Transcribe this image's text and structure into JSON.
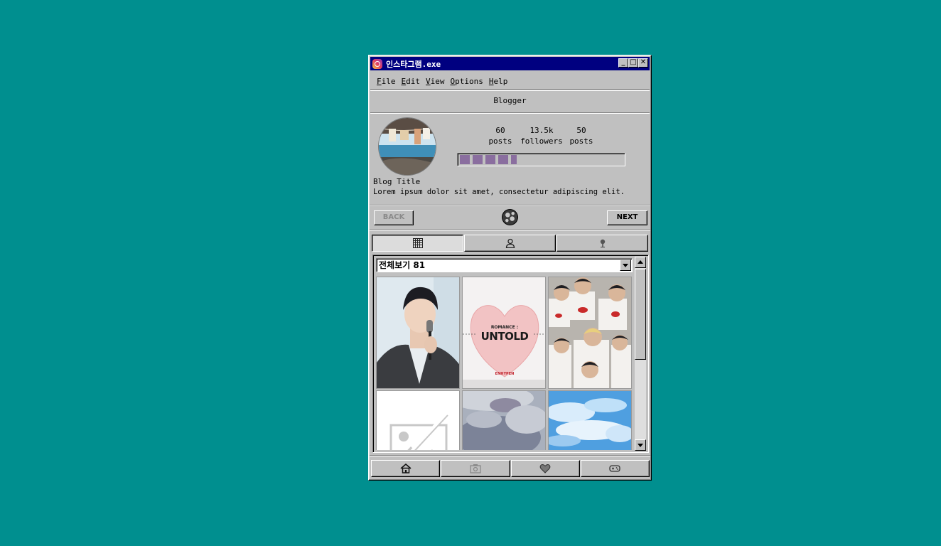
{
  "window": {
    "title": "인스타그램.exe",
    "minimize": "_",
    "maximize": "□",
    "close": "✕"
  },
  "menu": [
    {
      "u": "F",
      "rest": "ile"
    },
    {
      "u": "E",
      "rest": "dit"
    },
    {
      "u": "V",
      "rest": "iew"
    },
    {
      "u": "O",
      "rest": "ptions"
    },
    {
      "u": "H",
      "rest": "elp"
    }
  ],
  "header": {
    "title": "Blogger"
  },
  "profile": {
    "stats": [
      {
        "value": "60",
        "label": "posts"
      },
      {
        "value": "13.5k",
        "label": "followers"
      },
      {
        "value": "50",
        "label": "posts"
      }
    ],
    "progress_fraction": 0.35,
    "bio_title": "Blog Title",
    "bio_text": "Lorem ipsum dolor sit amet, consectetur adipiscing elit."
  },
  "nav": {
    "back": "BACK",
    "next": "NEXT",
    "center_icon": "globe-icon"
  },
  "tabs": [
    "grid-icon",
    "user-icon",
    "location-pin-icon"
  ],
  "album": {
    "select_value": "전체보기 81",
    "cells": [
      {
        "kind": "photo-singer"
      },
      {
        "kind": "album-cover",
        "small": "ROMANCE :",
        "big": "UNTOLD",
        "brand": "ENHYPEN"
      },
      {
        "kind": "photo-group"
      },
      {
        "kind": "placeholder"
      },
      {
        "kind": "photo-water"
      },
      {
        "kind": "photo-sky"
      }
    ]
  },
  "bottom_nav": [
    "home-icon",
    "camera-icon",
    "heart-icon",
    "game-controller-icon"
  ],
  "colors": {
    "desktop": "#008f8f",
    "titlebar": "#000080",
    "window": "#c0c0c0",
    "progress": "#8a6e9f"
  }
}
